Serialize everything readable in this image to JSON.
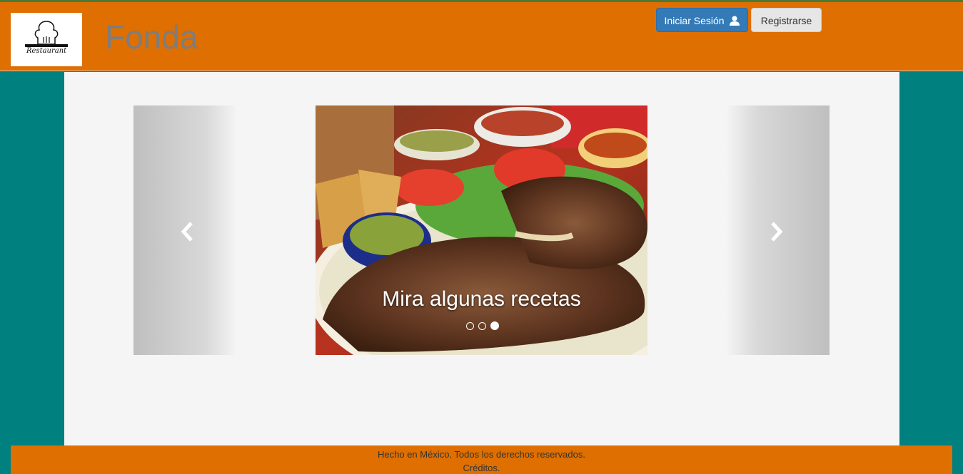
{
  "header": {
    "logo_text": "Restaurant",
    "brand": "Fonda",
    "login_label": "Iniciar Sesión",
    "register_label": "Registrarse"
  },
  "carousel": {
    "caption": "Mira algunas recetas",
    "slide_count": 3,
    "active_slide": 3
  },
  "footer": {
    "line1": "Hecho en México. Todos los derechos reservados.",
    "line2": "Créditos."
  },
  "colors": {
    "header": "#de6f00",
    "background": "#00807f",
    "login_button": "#337ab7"
  }
}
